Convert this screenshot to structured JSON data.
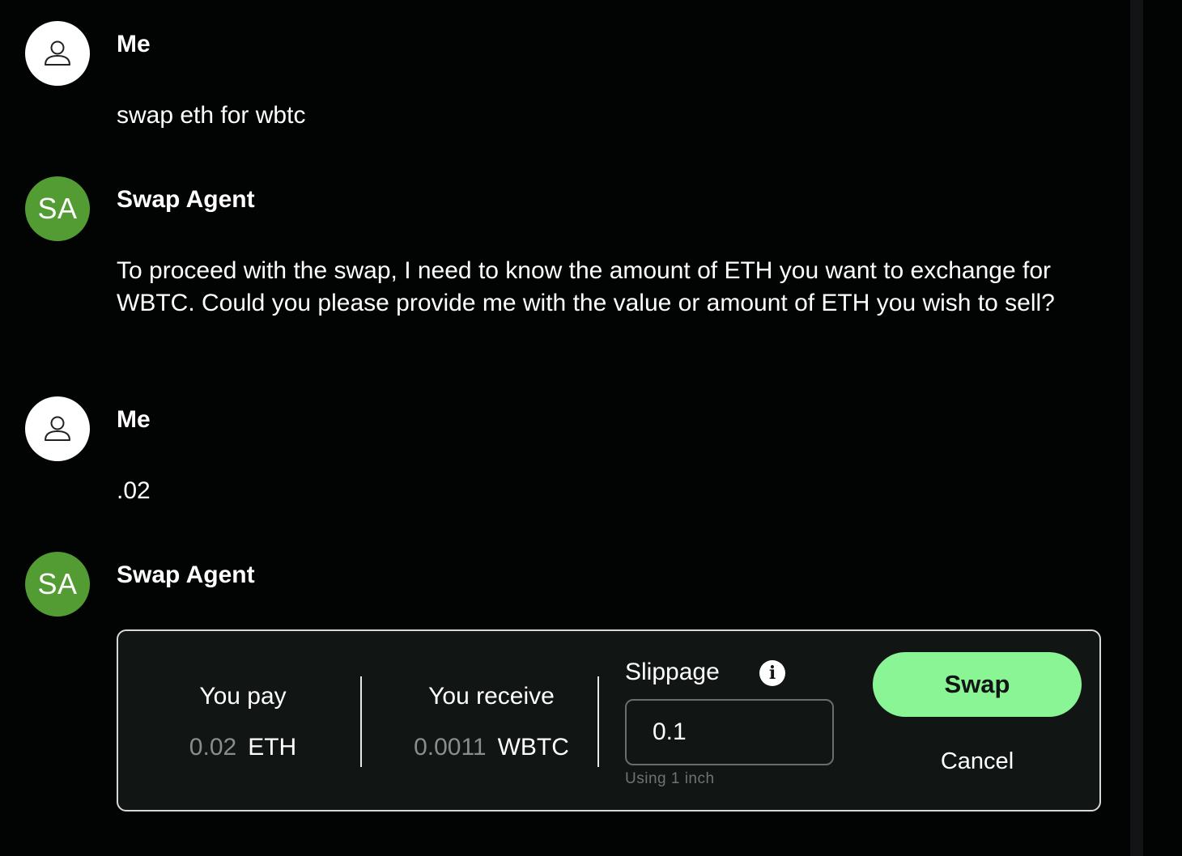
{
  "messages": [
    {
      "sender": "Me",
      "text": "swap eth for wbtc"
    },
    {
      "sender": "Swap Agent",
      "initials": "SA",
      "text": "To proceed with the swap, I need to know the amount of ETH you want to exchange for WBTC. Could you please provide me with the value or amount of ETH you wish to sell?"
    },
    {
      "sender": "Me",
      "text": ".02"
    },
    {
      "sender": "Swap Agent",
      "initials": "SA"
    }
  ],
  "swap": {
    "pay_label": "You pay",
    "pay_amount": "0.02",
    "pay_symbol": "ETH",
    "receive_label": "You receive",
    "receive_amount": "0.0011",
    "receive_symbol": "WBTC",
    "slippage_label": "Slippage",
    "slippage_value": "0.1",
    "info_icon": "i",
    "using_text": "Using 1 inch",
    "swap_label": "Swap",
    "cancel_label": "Cancel"
  },
  "icons": {
    "user_avatar": "person-icon",
    "info": "info-icon"
  },
  "colors": {
    "background": "#020303",
    "agent_avatar": "#539b33",
    "swap_button": "#8af595",
    "card_border": "#d7d9d8"
  }
}
